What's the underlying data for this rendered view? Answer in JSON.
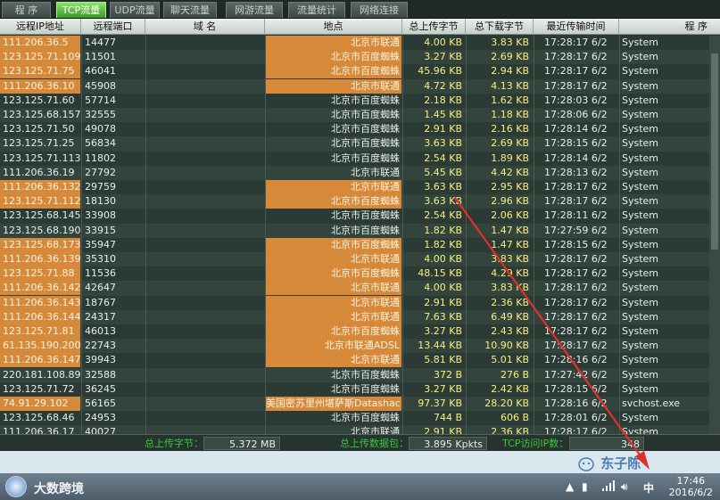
{
  "tabs": [
    {
      "label": "程 序",
      "active": false
    },
    {
      "label": "TCP流量",
      "active": true
    },
    {
      "label": "UDP流量",
      "active": false
    },
    {
      "label": "聊天流量",
      "active": false
    },
    {
      "label": "网游流量",
      "active": false
    },
    {
      "label": "流量统计",
      "active": false
    },
    {
      "label": "网络连接",
      "active": false
    }
  ],
  "columns": [
    "远程IP地址",
    "远程端口",
    "域 名",
    "地点",
    "总上传字节",
    "总下载字节",
    "最近传输时间",
    "程 序"
  ],
  "rows": [
    {
      "ip": "111.206.36.5",
      "port": "14477",
      "loc": "北京市联通",
      "up": "4.00 KB",
      "down": "3.83 KB",
      "time": "17:28:17 6/2",
      "proc": "System",
      "hl": true
    },
    {
      "ip": "123.125.71.109",
      "port": "11501",
      "loc": "北京市百度蜘蛛",
      "up": "3.27 KB",
      "down": "2.69 KB",
      "time": "17:28:17 6/2",
      "proc": "System",
      "hl": true
    },
    {
      "ip": "123.125.71.75",
      "port": "46041",
      "loc": "北京市百度蜘蛛",
      "up": "45.96 KB",
      "down": "2.94 KB",
      "time": "17:28:17 6/2",
      "proc": "System",
      "hl": true
    },
    {
      "ip": "111.206.36.10",
      "port": "45908",
      "loc": "北京市联通",
      "up": "4.72 KB",
      "down": "4.13 KB",
      "time": "17:28:17 6/2",
      "proc": "System",
      "hl": true
    },
    {
      "ip": "123.125.71.60",
      "port": "57714",
      "loc": "北京市百度蜘蛛",
      "up": "2.18 KB",
      "down": "1.62 KB",
      "time": "17:28:03 6/2",
      "proc": "System",
      "hl": false
    },
    {
      "ip": "123.125.68.157",
      "port": "32555",
      "loc": "北京市百度蜘蛛",
      "up": "1.45 KB",
      "down": "1.18 KB",
      "time": "17:28:06 6/2",
      "proc": "System",
      "hl": false
    },
    {
      "ip": "123.125.71.50",
      "port": "49078",
      "loc": "北京市百度蜘蛛",
      "up": "2.91 KB",
      "down": "2.16 KB",
      "time": "17:28:14 6/2",
      "proc": "System",
      "hl": false
    },
    {
      "ip": "123.125.71.25",
      "port": "56834",
      "loc": "北京市百度蜘蛛",
      "up": "3.63 KB",
      "down": "2.69 KB",
      "time": "17:28:15 6/2",
      "proc": "System",
      "hl": false
    },
    {
      "ip": "123.125.71.113",
      "port": "11802",
      "loc": "北京市百度蜘蛛",
      "up": "2.54 KB",
      "down": "1.89 KB",
      "time": "17:28:14 6/2",
      "proc": "System",
      "hl": false
    },
    {
      "ip": "111.206.36.19",
      "port": "27792",
      "loc": "北京市联通",
      "up": "5.45 KB",
      "down": "4.42 KB",
      "time": "17:28:13 6/2",
      "proc": "System",
      "hl": false
    },
    {
      "ip": "111.206.36.132",
      "port": "29759",
      "loc": "北京市联通",
      "up": "3.63 KB",
      "down": "2.95 KB",
      "time": "17:28:17 6/2",
      "proc": "System",
      "hl": true
    },
    {
      "ip": "123.125.71.112",
      "port": "18130",
      "loc": "北京市百度蜘蛛",
      "up": "3.63 KB",
      "down": "2.96 KB",
      "time": "17:28:17 6/2",
      "proc": "System",
      "hl": true
    },
    {
      "ip": "123.125.68.145",
      "port": "33908",
      "loc": "北京市百度蜘蛛",
      "up": "2.54 KB",
      "down": "2.06 KB",
      "time": "17:28:11 6/2",
      "proc": "System",
      "hl": false
    },
    {
      "ip": "123.125.68.190",
      "port": "33915",
      "loc": "北京市百度蜘蛛",
      "up": "1.82 KB",
      "down": "1.47 KB",
      "time": "17:27:59 6/2",
      "proc": "System",
      "hl": false
    },
    {
      "ip": "123.125.68.173",
      "port": "35947",
      "loc": "北京市百度蜘蛛",
      "up": "1.82 KB",
      "down": "1.47 KB",
      "time": "17:28:15 6/2",
      "proc": "System",
      "hl": true
    },
    {
      "ip": "111.206.36.139",
      "port": "35310",
      "loc": "北京市联通",
      "up": "4.00 KB",
      "down": "3.83 KB",
      "time": "17:28:17 6/2",
      "proc": "System",
      "hl": true
    },
    {
      "ip": "123.125.71.88",
      "port": "11536",
      "loc": "北京市百度蜘蛛",
      "up": "48.15 KB",
      "down": "4.29 KB",
      "time": "17:28:17 6/2",
      "proc": "System",
      "hl": true
    },
    {
      "ip": "111.206.36.142",
      "port": "42647",
      "loc": "北京市联通",
      "up": "4.00 KB",
      "down": "3.83 KB",
      "time": "17:28:17 6/2",
      "proc": "System",
      "hl": true
    },
    {
      "ip": "111.206.36.143",
      "port": "18767",
      "loc": "北京市联通",
      "up": "2.91 KB",
      "down": "2.36 KB",
      "time": "17:28:17 6/2",
      "proc": "System",
      "hl": true
    },
    {
      "ip": "111.206.36.144",
      "port": "24317",
      "loc": "北京市联通",
      "up": "7.63 KB",
      "down": "6.49 KB",
      "time": "17:28:17 6/2",
      "proc": "System",
      "hl": true
    },
    {
      "ip": "123.125.71.81",
      "port": "46013",
      "loc": "北京市百度蜘蛛",
      "up": "3.27 KB",
      "down": "2.43 KB",
      "time": "17:28:17 6/2",
      "proc": "System",
      "hl": true
    },
    {
      "ip": "61.135.190.200",
      "port": "22743",
      "loc": "北京市联通ADSL",
      "up": "13.44 KB",
      "down": "10.90 KB",
      "time": "17:28:17 6/2",
      "proc": "System",
      "hl": true
    },
    {
      "ip": "111.206.36.147",
      "port": "39943",
      "loc": "北京市联通",
      "up": "5.81 KB",
      "down": "5.01 KB",
      "time": "17:28:16 6/2",
      "proc": "System",
      "hl": true
    },
    {
      "ip": "220.181.108.89",
      "port": "32588",
      "loc": "北京市百度蜘蛛",
      "up": "372 B",
      "down": "276 B",
      "time": "17:27:42 6/2",
      "proc": "System",
      "hl": false
    },
    {
      "ip": "123.125.71.72",
      "port": "36245",
      "loc": "北京市百度蜘蛛",
      "up": "3.27 KB",
      "down": "2.42 KB",
      "time": "17:28:15 6/2",
      "proc": "System",
      "hl": false
    },
    {
      "ip": "74.91.29.102",
      "port": "56165",
      "loc": "美国密苏里州堪萨斯Datashac...",
      "up": "97.37 KB",
      "down": "28.20 KB",
      "time": "17:28:16 6/2",
      "proc": "svchost.exe",
      "hl": true
    },
    {
      "ip": "123.125.68.46",
      "port": "24953",
      "loc": "北京市百度蜘蛛",
      "up": "744 B",
      "down": "606 B",
      "time": "17:28:01 6/2",
      "proc": "System",
      "hl": false
    },
    {
      "ip": "111.206.36.17",
      "port": "40027",
      "loc": "北京市联通",
      "up": "2.91 KB",
      "down": "2.36 KB",
      "time": "17:28:17 6/2",
      "proc": "System",
      "hl": false
    }
  ],
  "status": {
    "upload_bytes_label": "总上传字节：",
    "upload_bytes_value": "5.372 MB",
    "upload_packets_label": "总上传数据包：",
    "upload_packets_value": "3.895 Kpkts",
    "tcp_ips_label": "TCP访问IP数：",
    "tcp_ips_value": "348"
  },
  "taskbar": {
    "brand": "大数跨境",
    "ime": "中",
    "time": "17:46",
    "date": "2016/6/2"
  },
  "watermark": "东子陈",
  "colors": {
    "highlight": "#d7893a",
    "row_bg": "#2b3a34",
    "status_label": "#37c937",
    "byte_text": "#f7f080",
    "arrow": "#e0302a"
  }
}
